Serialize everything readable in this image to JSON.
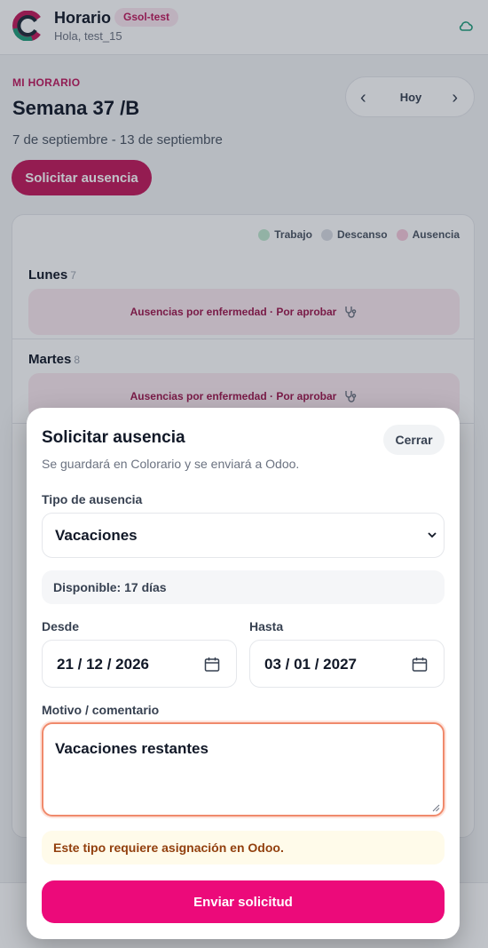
{
  "header": {
    "title": "Horario",
    "org_badge": "Gsol-test",
    "greeting": "Hola, test_15"
  },
  "schedule": {
    "eyebrow": "MI HORARIO",
    "week_title": "Semana 37 /B",
    "date_range": "7 de septiembre - 13 de septiembre",
    "request_button": "Solicitar ausencia",
    "nav": {
      "prev": "‹",
      "today": "Hoy",
      "next": "›"
    },
    "legend": [
      {
        "label": "Trabajo",
        "color": "#bfe8cf"
      },
      {
        "label": "Descanso",
        "color": "#d9dce2"
      },
      {
        "label": "Ausencia",
        "color": "#f7c9dc"
      }
    ],
    "days": [
      {
        "name": "Lunes",
        "number": "7",
        "absence": "Ausencias por enfermedad · Por aprobar"
      },
      {
        "name": "Martes",
        "number": "8",
        "absence": "Ausencias por enfermedad · Por aprobar"
      }
    ]
  },
  "modal": {
    "title": "Solicitar ausencia",
    "subtitle": "Se guardará en Colorario y se enviará a Odoo.",
    "close_label": "Cerrar",
    "type_label": "Tipo de ausencia",
    "type_value": "Vacaciones",
    "available": "Disponible: 17 días",
    "from_label": "Desde",
    "from_value": "21 / 12 / 2026",
    "to_label": "Hasta",
    "to_value": "03 / 01 / 2027",
    "comment_label": "Motivo / comentario",
    "comment_value": "Vacaciones restantes",
    "warning": "Este tipo requiere asignación en Odoo.",
    "submit_label": "Enviar solicitud"
  },
  "colors": {
    "brand": "#c2185b",
    "submit": "#ec0a7a",
    "focus_border": "#f08a6c",
    "warning_text": "#92400e"
  }
}
